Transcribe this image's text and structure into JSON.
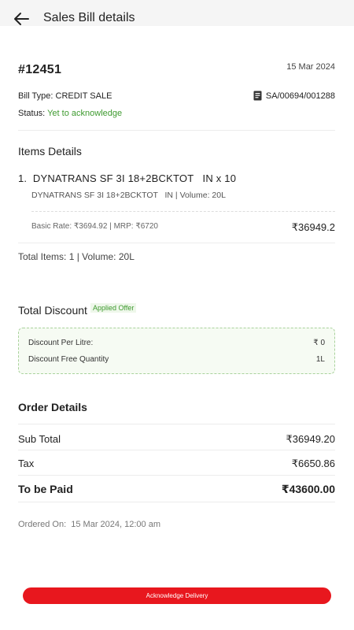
{
  "header": {
    "title": "Sales Bill details",
    "back_icon": "arrow-left-icon"
  },
  "bill": {
    "number": "#12451",
    "date": "15 Mar 2024",
    "type_label": "Bill Type: ",
    "type_value": "CREDIT SALE",
    "reference": "SA/00694/001288",
    "reference_icon": "receipt-icon",
    "status_label": "Status: ",
    "status_value": "Yet to acknowledge",
    "status_color": "#3e9a2f"
  },
  "items": {
    "title": "Items Details",
    "list": [
      {
        "index": "1.",
        "name": "DYNATRANS SF 3I 18+2BCKTOT   IN x 10",
        "subtitle": "DYNATRANS SF 3I 18+2BCKTOT   IN | Volume: 20L",
        "rate": "Basic Rate: ₹3694.92 | MRP: ₹6720",
        "amount": "₹36949.2"
      }
    ],
    "summary": "Total Items: 1 | Volume: 20L"
  },
  "discount": {
    "title": "Total Discount",
    "badge": "Applied Offer",
    "rows": [
      {
        "label": "Discount Per Litre:",
        "value": "₹ 0"
      },
      {
        "label": "Discount Free Quantity",
        "value": "1L"
      }
    ]
  },
  "order": {
    "title": "Order Details",
    "sub_total_label": "Sub Total",
    "sub_total_value": "₹36949.20",
    "tax_label": "Tax",
    "tax_value": "₹6650.86",
    "to_pay_label": "To be Paid",
    "to_pay_value": "₹43600.00",
    "ordered_on": "Ordered On:  15 Mar 2024, 12:00 am"
  },
  "actions": {
    "acknowledge_label": "Acknowledge Delivery",
    "accent_color": "#e8171e"
  }
}
